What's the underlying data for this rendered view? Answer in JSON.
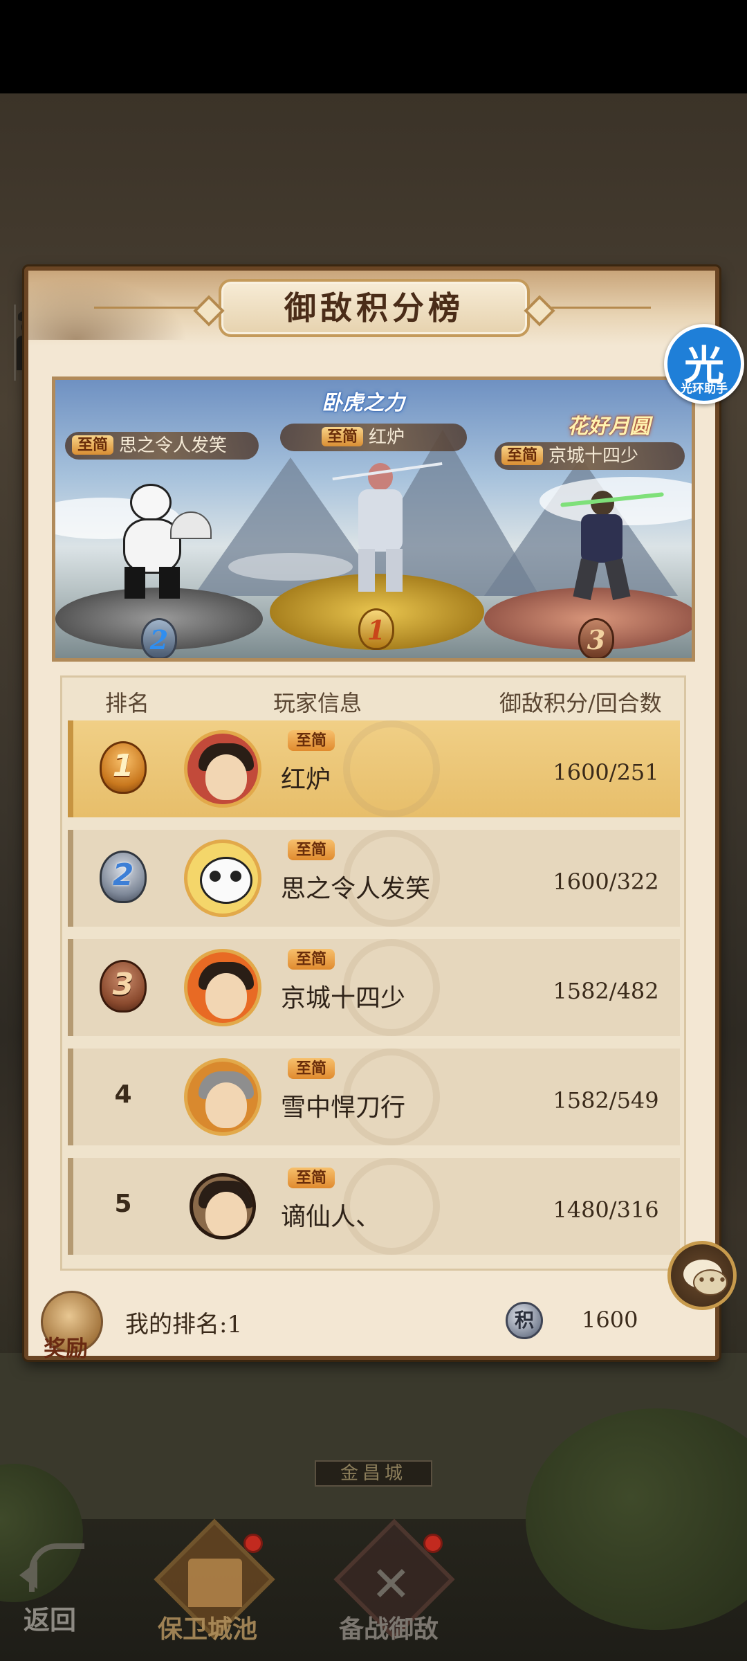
{
  "panel": {
    "title": "御敌积分榜"
  },
  "podium": {
    "title_art_center": "卧虎之力",
    "title_art_right": "花好月圆",
    "entries": [
      {
        "rank": "2",
        "tag": "至简",
        "name": "思之令人发笑"
      },
      {
        "rank": "1",
        "tag": "至简",
        "name": "红炉"
      },
      {
        "rank": "3",
        "tag": "至简",
        "name": "京城十四少"
      }
    ]
  },
  "table": {
    "headers": {
      "rank": "排名",
      "player": "玩家信息",
      "score": "御敌积分/回合数"
    },
    "rows": [
      {
        "rank": "1",
        "tag": "至简",
        "name": "红炉",
        "score": "1600/251"
      },
      {
        "rank": "2",
        "tag": "至简",
        "name": "思之令人发笑",
        "score": "1600/322"
      },
      {
        "rank": "3",
        "tag": "至简",
        "name": "京城十四少",
        "score": "1582/482"
      },
      {
        "rank": "4",
        "tag": "至简",
        "name": "雪中悍刀行",
        "score": "1582/549"
      },
      {
        "rank": "5",
        "tag": "至简",
        "name": "谪仙人、",
        "score": "1480/316"
      }
    ]
  },
  "footer": {
    "reward_label": "奖励",
    "my_rank": "我的排名:1",
    "score_icon_char": "积",
    "my_score": "1600"
  },
  "floating": {
    "helper_big": "光",
    "helper_small": "光环助手"
  },
  "background": {
    "gate_sign": "金昌城"
  },
  "bottom_nav": {
    "back": "返回",
    "defend": "保卫城池",
    "prepare": "备战御敌"
  },
  "colors": {
    "panel_bg": "#f3e7d3",
    "first_row": "#e7be6a",
    "tag": "#e08a2e",
    "medal_gold": "#c9781e",
    "medal_silver": "#3d7fd6",
    "medal_bronze": "#8a4a2e"
  }
}
